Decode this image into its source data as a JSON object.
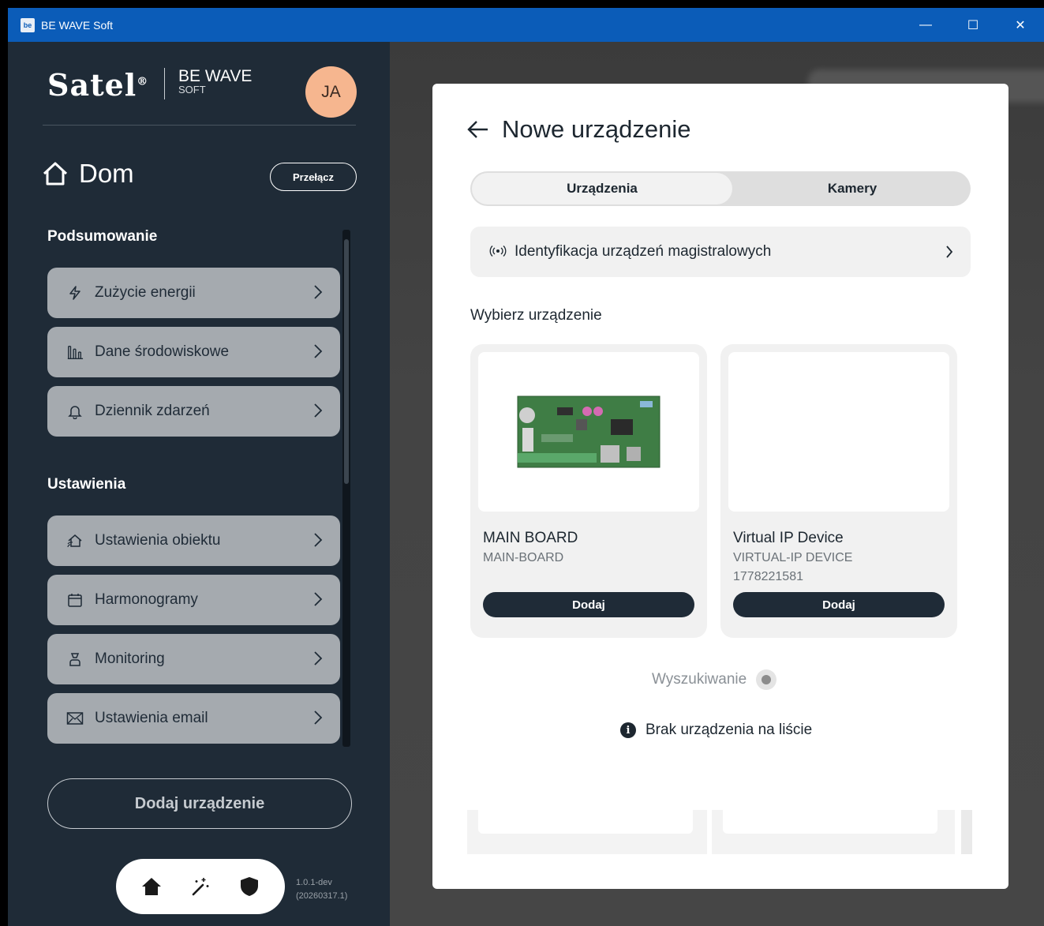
{
  "window": {
    "title": "BE WAVE Soft",
    "app_icon": "be",
    "controls": {
      "minimize": "—",
      "maximize": "☐",
      "close": "✕"
    }
  },
  "sidebar": {
    "brand": {
      "logo": "Satel",
      "product": "BE WAVE",
      "product_sub": "SOFT"
    },
    "avatar": "JA",
    "location": {
      "name": "Dom",
      "switch_label": "Przełącz"
    },
    "summary": {
      "title": "Podsumowanie",
      "items": [
        {
          "label": "Zużycie energii",
          "icon": "lightning-icon"
        },
        {
          "label": "Dane środowiskowe",
          "icon": "bar-chart-icon"
        },
        {
          "label": "Dziennik zdarzeń",
          "icon": "bell-icon"
        }
      ]
    },
    "settings": {
      "title": "Ustawienia",
      "items": [
        {
          "label": "Ustawienia obiektu",
          "icon": "house-settings-icon"
        },
        {
          "label": "Harmonogramy",
          "icon": "calendar-icon"
        },
        {
          "label": "Monitoring",
          "icon": "person-icon"
        },
        {
          "label": "Ustawienia email",
          "icon": "envelope-icon"
        }
      ]
    },
    "add_device": "Dodaj urządzenie",
    "bottom_nav": [
      "home-icon",
      "magic-wand-icon",
      "shield-icon"
    ],
    "version": {
      "line1": "1.0.1-dev",
      "line2": "(20260317.1)"
    }
  },
  "modal": {
    "title": "Nowe urządzenie",
    "tabs": [
      {
        "label": "Urządzenia",
        "active": true
      },
      {
        "label": "Kamery",
        "active": false
      }
    ],
    "identify": {
      "label": "Identyfikacja urządzeń magistralowych",
      "icon": "broadcast-icon"
    },
    "choose_label": "Wybierz urządzenie",
    "devices": [
      {
        "name": "MAIN BOARD",
        "model": "MAIN-BOARD",
        "serial": "",
        "add_label": "Dodaj",
        "image": "circuit-board-image"
      },
      {
        "name": "Virtual IP Device",
        "model": "VIRTUAL-IP DEVICE",
        "serial": "1778221581",
        "add_label": "Dodaj",
        "image": ""
      }
    ],
    "searching": "Wyszukiwanie",
    "missing": "Brak urządzenia na liście"
  },
  "colors": {
    "titlebar": "#0b5cb8",
    "sidebar": "#1f2b37",
    "menu_item": "#a5aaaf",
    "avatar": "#f6b68f",
    "button_dark": "#1f2b37"
  }
}
